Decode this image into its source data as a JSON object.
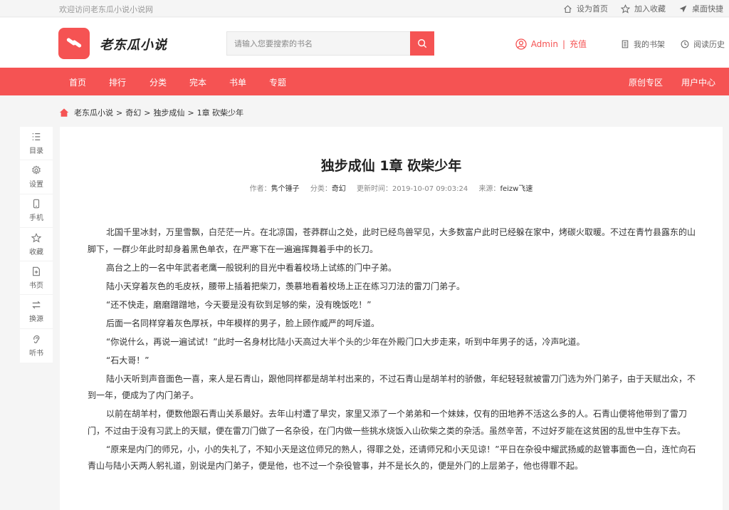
{
  "topbar": {
    "welcome": "欢迎访问老东瓜小说小说网",
    "links": [
      "设为首页",
      "加入收藏",
      "桌面快捷"
    ]
  },
  "header": {
    "logo_text": "老东瓜小说",
    "search_placeholder": "请输入您要搜索的书名",
    "user_name": "Admin",
    "user_sep": "|",
    "recharge": "充值",
    "bookshelf": "我的书架",
    "history": "阅读历史"
  },
  "nav": {
    "items": [
      "首页",
      "排行",
      "分类",
      "完本",
      "书单",
      "专题"
    ],
    "right_items": [
      "原创专区",
      "用户中心"
    ]
  },
  "breadcrumb": {
    "items": [
      "老东瓜小说",
      "奇幻",
      "独步成仙",
      "1章 砍柴少年"
    ],
    "sep": ">"
  },
  "side": {
    "items": [
      {
        "label": "目录",
        "icon": "list-icon"
      },
      {
        "label": "设置",
        "icon": "gear-icon"
      },
      {
        "label": "手机",
        "icon": "phone-icon"
      },
      {
        "label": "收藏",
        "icon": "star-icon"
      },
      {
        "label": "书页",
        "icon": "book-page-icon"
      },
      {
        "label": "换源",
        "icon": "swap-icon"
      },
      {
        "label": "听书",
        "icon": "listen-icon"
      }
    ]
  },
  "chapter": {
    "title": "独步成仙 1章 砍柴少年",
    "meta": {
      "author_label": "作者：",
      "author": "隽个锤子",
      "category_label": "分类：",
      "category": "奇幻",
      "updated_label": "更新时间：",
      "updated": "2019-10-07 09:03:24",
      "source_label": "来源：",
      "source": "feizw飞速"
    },
    "paragraphs": [
      "北国千里冰封，万里雪飘，白茫茫一片。在北凉国，苍莽群山之处，此时已经鸟兽罕见，大多数富户此时已经躲在家中，烤碳火取暖。不过在青竹县露东的山脚下，一群少年此时却身着黑色单衣，在严寒下在一遍遍挥舞着手中的长刀。",
      "高台之上的一名中年武者老鹰一般锐利的目光中看着校场上试练的门中子弟。",
      "陆小天穿着灰色的毛皮袄，腰带上插着把柴刀，羡慕地看着校场上正在练习刀法的雷刀门弟子。",
      "“还不快走，磨磨蹭蹭地，今天要是没有砍到足够的柴，没有晚饭吃！”",
      "后面一名同样穿着灰色厚袄，中年模样的男子，脸上顾作威严的呵斥道。",
      "“你说什么，再说一遍试试！”此时一名身材比陆小天高过大半个头的少年在外殿门口大步走来，听到中年男子的话，冷声叱道。",
      "“石大哥！”",
      "陆小天听到声音面色一喜，来人是石青山，跟他同样都是胡羊村出来的，不过石青山是胡羊村的骄傲，年纪轻轻就被雷刀门选为外门弟子，由于天赋出众，不到一年，便成为了内门弟子。",
      "以前在胡羊村，便数他跟石青山关系最好。去年山村遭了旱灾，家里又添了一个弟弟和一个妹妹，仅有的田地养不活这么多的人。石青山便将他带到了雷刀门，不过由于没有习武上的天赋，便在雷刀门做了一名杂役，在门内做一些挑水烧饭入山砍柴之类的杂活。虽然辛苦，不过好歹能在这贫困的乱世中生存下去。",
      "“原来是内门的师兄，小，小的失礼了，不知小天是这位师兄的熟人，得罪之处，还请师兄和小天见谅！”平日在杂役中耀武扬威的赵管事面色一白，连忙向石青山与陆小天两人躬礼道，别说是内门弟子，便是他，也不过一个杂役管事，并不是长久的，便是外门的上层弟子，他也得罪不起。"
    ]
  }
}
